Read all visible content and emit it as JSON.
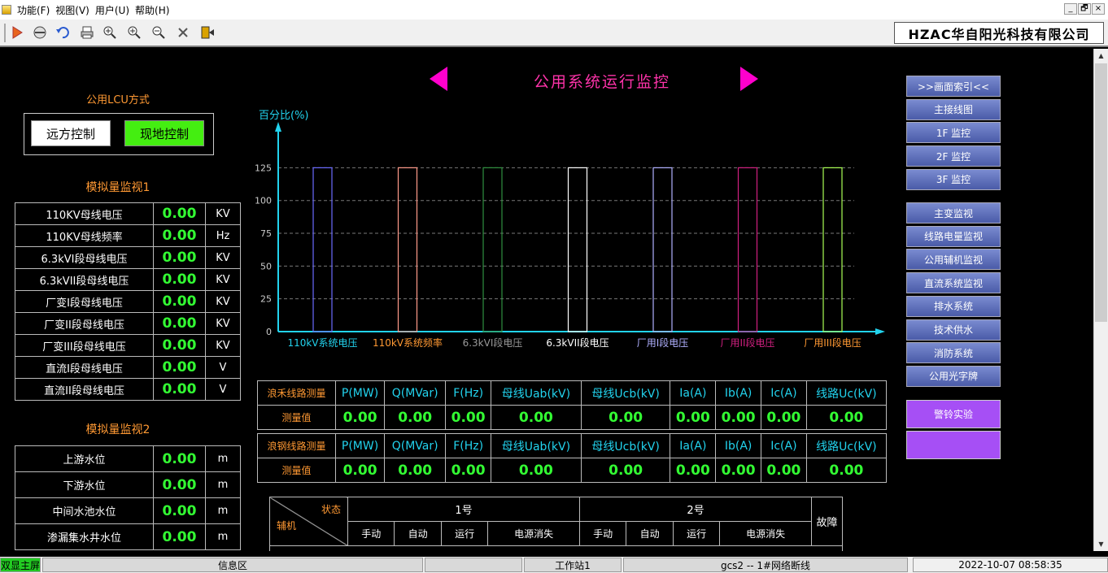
{
  "menu": {
    "items": [
      "功能(F)",
      "视图(V)",
      "用户(U)",
      "帮助(H)"
    ]
  },
  "window_controls": [
    "_",
    "🗗",
    "×"
  ],
  "toolbar": {
    "icons": [
      "play-icon",
      "stop-icon",
      "undo-icon",
      "print-icon",
      "zoom-fit-icon",
      "zoom-in-icon",
      "zoom-out-icon",
      "tools-icon",
      "exit-icon"
    ]
  },
  "company": "HZAC华自阳光科技有限公司",
  "page": {
    "title": "公用系统运行监控"
  },
  "lcu": {
    "title": "公用LCU方式",
    "remote": "远方控制",
    "local": "现地控制"
  },
  "analog1": {
    "title": "模拟量监视1",
    "rows": [
      {
        "name": "110KV母线电压",
        "value": "0.00",
        "unit": "KV"
      },
      {
        "name": "110KV母线频率",
        "value": "0.00",
        "unit": "Hz"
      },
      {
        "name": "6.3kVI段母线电压",
        "value": "0.00",
        "unit": "KV"
      },
      {
        "name": "6.3kVII段母线电压",
        "value": "0.00",
        "unit": "KV"
      },
      {
        "name": "厂变I段母线电压",
        "value": "0.00",
        "unit": "KV"
      },
      {
        "name": "厂变II段母线电压",
        "value": "0.00",
        "unit": "KV"
      },
      {
        "name": "厂变III段母线电压",
        "value": "0.00",
        "unit": "KV"
      },
      {
        "name": "直流I段母线电压",
        "value": "0.00",
        "unit": "V"
      },
      {
        "name": "直流II段母线电压",
        "value": "0.00",
        "unit": "V"
      }
    ]
  },
  "analog2": {
    "title": "模拟量监视2",
    "rows": [
      {
        "name": "上游水位",
        "value": "0.00",
        "unit": "m"
      },
      {
        "name": "下游水位",
        "value": "0.00",
        "unit": "m"
      },
      {
        "name": "中间水池水位",
        "value": "0.00",
        "unit": "m"
      },
      {
        "name": "渗漏集水井水位",
        "value": "0.00",
        "unit": "m"
      }
    ]
  },
  "chart_data": {
    "type": "bar",
    "ylabel": "百分比(%)",
    "ylim": [
      0,
      125
    ],
    "yticks": [
      0,
      25,
      50,
      75,
      100,
      125
    ],
    "categories": [
      "110kV系统电压",
      "110kV系统频率",
      "6.3kVI段电压",
      "6.3kVII段电压",
      "厂用I段电压",
      "厂用II段电压",
      "厂用III段电压"
    ],
    "values": [
      125,
      125,
      125,
      125,
      125,
      125,
      125
    ],
    "bar_colors": [
      "#6a6aff",
      "#ff9a8a",
      "#2f8f3f",
      "#ffffff",
      "#b0b0ff",
      "#d02080",
      "#aaff55"
    ],
    "label_colors": [
      "#22d3ee",
      "#ff9933",
      "#999999",
      "#ffffff",
      "#b0b0ff",
      "#d02080",
      "#ff9933"
    ],
    "grid": true
  },
  "line1": {
    "name": "浪禾线路测量",
    "value_label": "测量值",
    "headers": [
      "P(MW)",
      "Q(MVar)",
      "F(Hz)",
      "母线Uab(kV)",
      "母线Ucb(kV)",
      "Ia(A)",
      "Ib(A)",
      "Ic(A)",
      "线路Uc(kV)"
    ],
    "values": [
      "0.00",
      "0.00",
      "0.00",
      "0.00",
      "0.00",
      "0.00",
      "0.00",
      "0.00",
      "0.00"
    ]
  },
  "line2": {
    "name": "浪钢线路测量",
    "value_label": "测量值",
    "headers": [
      "P(MW)",
      "Q(MVar)",
      "F(Hz)",
      "母线Uab(kV)",
      "母线Ucb(kV)",
      "Ia(A)",
      "Ib(A)",
      "Ic(A)",
      "线路Uc(kV)"
    ],
    "values": [
      "0.00",
      "0.00",
      "0.00",
      "0.00",
      "0.00",
      "0.00",
      "0.00",
      "0.00",
      "0.00"
    ]
  },
  "aux": {
    "state": "状态",
    "aux": "辅机",
    "unit1": "1号",
    "unit2": "2号",
    "fault": "故障",
    "cols": [
      "手动",
      "自动",
      "运行",
      "电源消失",
      "手动",
      "自动",
      "运行",
      "电源消失"
    ]
  },
  "nav": {
    "group1": [
      ">>画面索引<<",
      "主接线图",
      "1F 监控",
      "2F 监控",
      "3F 监控"
    ],
    "group2": [
      "主变监视",
      "线路电量监视",
      "公用辅机监视",
      "直流系统监视",
      "排水系统",
      "技术供水",
      "消防系统",
      "公用光字牌"
    ],
    "alarm_test": "警铃实验",
    "extra": ""
  },
  "status": {
    "screen": "双显主屏",
    "info": "信息区",
    "workstation": "工作站1",
    "network": "gcs2 -- 1#网络断线",
    "datetime": "2022-10-07 08:58:35"
  },
  "colors": {
    "accent_title": "#ff33aa",
    "value_green": "#33ff33",
    "label_orange": "#ff9933",
    "axis_cyan": "#22d3ee",
    "nav_blue": "#5566b8",
    "alarm_purple": "#a64ff5"
  }
}
